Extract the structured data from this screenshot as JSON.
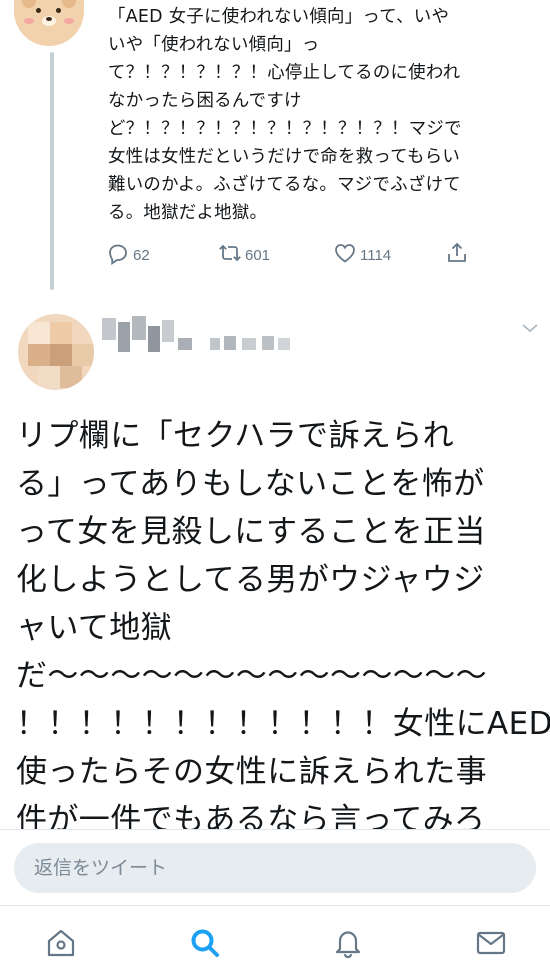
{
  "parent_tweet": {
    "lines": [
      "「AED 女子に使われない傾向」って、いや",
      "いや「使われない傾向」っ",
      "て？！？！？！？！心停止してるのに使われ",
      "なかったら困るんですけ",
      "ど？！？！？！？！？！？！？！？！マジで",
      "女性は女性だというだけで命を救ってもらい",
      "難いのかよ。ふざけてるな。マジでふざけて",
      "る。地獄だよ地獄。"
    ],
    "actions": {
      "reply_count": "62",
      "retweet_count": "601",
      "like_count": "1114"
    }
  },
  "tweet": {
    "lines": [
      "リプ欄に「セクハラで訴えられ",
      "る」ってありもしないことを怖が",
      "って女を見殺しにすることを正当",
      "化しようとしてる男がウジャウジ",
      "ャいて地獄",
      "だ〜〜〜〜〜〜〜〜〜〜〜〜〜〜",
      "！！！！！！！！！！！！女性にAED",
      "使ったらその女性に訴えられた事",
      "件が一件でもあるなら言ってみろ"
    ]
  },
  "reply_box": {
    "placeholder": "返信をツイート"
  },
  "tabbar": {
    "icons": [
      "home-icon",
      "search-icon",
      "bell-icon",
      "mail-icon"
    ],
    "active": "search-icon",
    "active_color": "#1da1f2"
  }
}
